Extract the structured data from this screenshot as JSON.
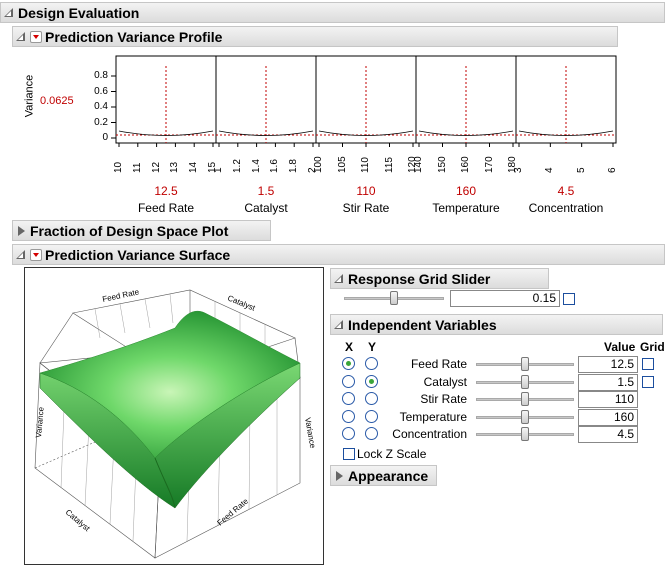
{
  "design_evaluation": {
    "title": "Design Evaluation"
  },
  "pred_var_profile": {
    "title": "Prediction Variance Profile",
    "y_label": "Variance",
    "y_current": "0.0625",
    "y_ticks": [
      "0.8",
      "0.6",
      "0.4",
      "0.2",
      "0"
    ],
    "factors": [
      {
        "name": "Feed Rate",
        "value": "12.5",
        "ticks": [
          "10",
          "11",
          "12",
          "13",
          "14",
          "15"
        ]
      },
      {
        "name": "Catalyst",
        "value": "1.5",
        "ticks": [
          "1",
          "1.2",
          "1.4",
          "1.6",
          "1.8",
          "2"
        ]
      },
      {
        "name": "Stir Rate",
        "value": "110",
        "ticks": [
          "100",
          "105",
          "110",
          "115",
          "120"
        ]
      },
      {
        "name": "Temperature",
        "value": "160",
        "ticks": [
          "140",
          "150",
          "160",
          "170",
          "180"
        ]
      },
      {
        "name": "Concentration",
        "value": "4.5",
        "ticks": [
          "3",
          "4",
          "5",
          "6"
        ]
      }
    ]
  },
  "fraction_plot": {
    "title": "Fraction of Design Space Plot"
  },
  "pred_var_surface": {
    "title": "Prediction Variance Surface",
    "surface_labels": {
      "feed_rate": "Feed Rate",
      "catalyst": "Catalyst",
      "variance": "Variance"
    },
    "response_grid": {
      "title": "Response Grid Slider",
      "value": "0.15"
    },
    "independent": {
      "title": "Independent Variables",
      "col_x": "X",
      "col_y": "Y",
      "col_value": "Value",
      "col_grid": "Grid",
      "vars": [
        {
          "name": "Feed Rate",
          "value": "12.5",
          "x": true,
          "y": false,
          "slider": 0.5
        },
        {
          "name": "Catalyst",
          "value": "1.5",
          "x": false,
          "y": true,
          "slider": 0.5
        },
        {
          "name": "Stir Rate",
          "value": "110",
          "x": false,
          "y": false,
          "slider": 0.5
        },
        {
          "name": "Temperature",
          "value": "160",
          "x": false,
          "y": false,
          "slider": 0.5
        },
        {
          "name": "Concentration",
          "value": "4.5",
          "x": false,
          "y": false,
          "slider": 0.5
        }
      ],
      "lock_z": "Lock Z Scale"
    },
    "appearance": {
      "title": "Appearance"
    }
  }
}
